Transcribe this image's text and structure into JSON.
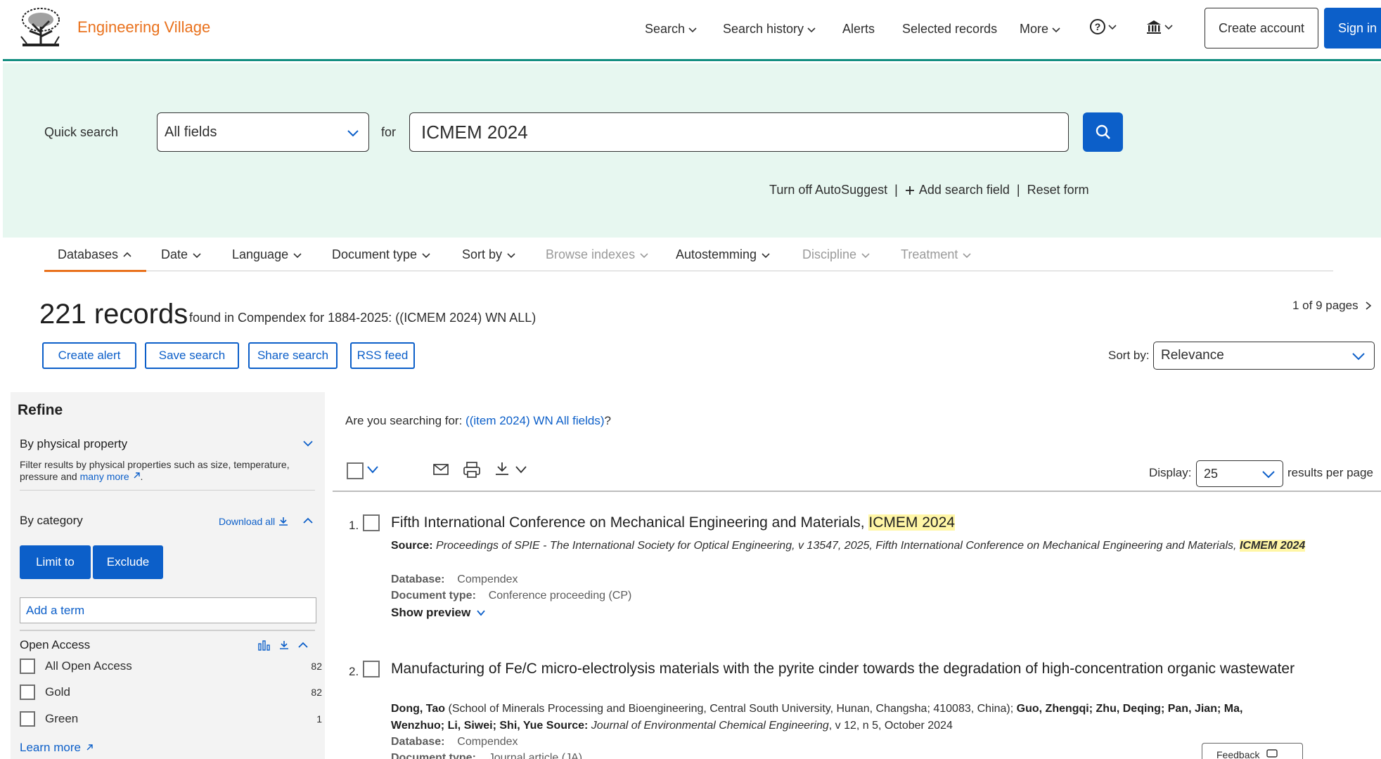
{
  "header": {
    "brand": "Engineering Village",
    "nav": [
      {
        "label": "Search",
        "has_menu": true
      },
      {
        "label": "Search history",
        "has_menu": true
      },
      {
        "label": "Alerts",
        "has_menu": false
      },
      {
        "label": "Selected records",
        "has_menu": false
      },
      {
        "label": "More",
        "has_menu": true
      }
    ],
    "create_account": "Create account",
    "sign_in": "Sign in",
    "accent": "#e9711c",
    "primary": "#0c5fc9"
  },
  "search": {
    "label": "Quick search",
    "field": "All fields",
    "for": "for",
    "query": "ICMEM 2024",
    "links": {
      "autosuggest": "Turn off AutoSuggest",
      "add_field": "Add search field",
      "reset": "Reset form"
    }
  },
  "tabs": [
    {
      "label": "Databases",
      "open": true,
      "disabled": false
    },
    {
      "label": "Date",
      "open": false,
      "disabled": false
    },
    {
      "label": "Language",
      "open": false,
      "disabled": false
    },
    {
      "label": "Document type",
      "open": false,
      "disabled": false
    },
    {
      "label": "Sort by",
      "open": false,
      "disabled": false
    },
    {
      "label": "Browse indexes",
      "open": false,
      "disabled": true
    },
    {
      "label": "Autostemming",
      "open": false,
      "disabled": false
    },
    {
      "label": "Discipline",
      "open": false,
      "disabled": true
    },
    {
      "label": "Treatment",
      "open": false,
      "disabled": true
    }
  ],
  "summary": {
    "count": "221 records",
    "description": "found in Compendex for 1884-2025: ((ICMEM 2024) WN ALL)",
    "pages": "1 of 9 pages",
    "actions": [
      "Create alert",
      "Save search",
      "Share search",
      "RSS feed"
    ],
    "sort_label": "Sort by:",
    "sort_value": "Relevance"
  },
  "refine": {
    "title": "Refine",
    "physical_label": "By physical property",
    "physical_help": "Filter results by physical properties such as size, temperature, pressure and",
    "physical_link": "many more",
    "category_label": "By category",
    "download_all": "Download all",
    "limit": "Limit to",
    "exclude": "Exclude",
    "term_placeholder": "Add a term",
    "open_access_label": "Open Access",
    "open_access": [
      {
        "label": "All Open Access",
        "count": "82"
      },
      {
        "label": "Gold",
        "count": "82"
      },
      {
        "label": "Green",
        "count": "1"
      }
    ],
    "learn_more": "Learn more"
  },
  "results": {
    "suggest_prefix": "Are you searching for:",
    "suggest_link": "((item 2024) WN All fields)",
    "suggest_suffix": "?",
    "display_label": "Display:",
    "display_value": "25",
    "per_page": "results per page",
    "items": [
      {
        "num": "1.",
        "title_pre": "Fifth International Conference on Mechanical Engineering and Materials,",
        "title_hl": "ICMEM 2024",
        "source_label": "Source:",
        "source_text": "Proceedings of SPIE - The International Society for Optical Engineering, v 13547, 2025, Fifth International Conference on Mechanical Engineering and Materials,",
        "source_hl": "ICMEM 2024",
        "database_label": "Database:",
        "database": "Compendex",
        "doctype_label": "Document type:",
        "doctype": "Conference proceeding (CP)",
        "preview": "Show preview"
      },
      {
        "num": "2.",
        "title": "Manufacturing of Fe/C micro-electrolysis materials with the pyrite cinder towards the degradation of high-concentration organic wastewater",
        "author_line1_a": "Dong, Tao",
        "author_line1_b": "(School of Minerals Processing and Bioengineering, Central South University, Hunan, Changsha; 410083, China);",
        "author_line1_c": "Guo, Zhengqi; Zhu, Deqing; Pan, Jian; Ma,",
        "author_line2_a": "Wenzhuo; Li, Siwei; Shi, Yue Source:",
        "author_line2_b": "Journal of Environmental Chemical Engineering",
        "author_line2_c": ", v 12, n 5, October 2024",
        "database_label": "Database:",
        "database": "Compendex",
        "doctype_label": "Document type:",
        "doctype": "Journal article (JA)"
      }
    ]
  },
  "feedback": "Feedback"
}
